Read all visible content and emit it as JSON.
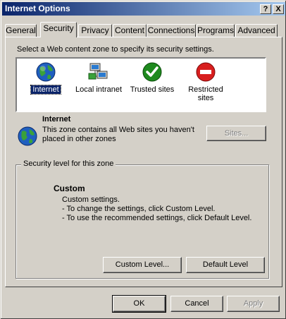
{
  "window": {
    "title": "Internet Options",
    "help_glyph": "?",
    "close_glyph": "X"
  },
  "tabs": [
    {
      "label": "General"
    },
    {
      "label": "Security",
      "active": true
    },
    {
      "label": "Privacy"
    },
    {
      "label": "Content"
    },
    {
      "label": "Connections"
    },
    {
      "label": "Programs"
    },
    {
      "label": "Advanced"
    }
  ],
  "security": {
    "instruction": "Select a Web content zone to specify its security settings.",
    "zones": [
      {
        "label": "Internet",
        "icon": "globe-icon",
        "selected": true
      },
      {
        "label": "Local intranet",
        "icon": "network-computers-icon"
      },
      {
        "label": "Trusted sites",
        "icon": "green-check-icon"
      },
      {
        "label": "Restricted sites",
        "icon": "red-no-entry-icon"
      }
    ],
    "selected_zone": {
      "title": "Internet",
      "description": "This zone contains all Web sites you haven't placed in other zones",
      "sites_button": "Sites..."
    },
    "level_group": {
      "legend": "Security level for this zone",
      "level_name": "Custom",
      "lines": [
        "Custom settings.",
        "- To change the settings, click Custom Level.",
        "- To use the recommended settings, click Default Level."
      ],
      "custom_level_button": "Custom Level...",
      "default_level_button": "Default Level"
    }
  },
  "footer": {
    "ok": "OK",
    "cancel": "Cancel",
    "apply": "Apply"
  },
  "colors": {
    "titlebar_start": "#0a246a",
    "titlebar_end": "#a6caf0",
    "face": "#d4d0c8",
    "selection": "#0a246a"
  }
}
